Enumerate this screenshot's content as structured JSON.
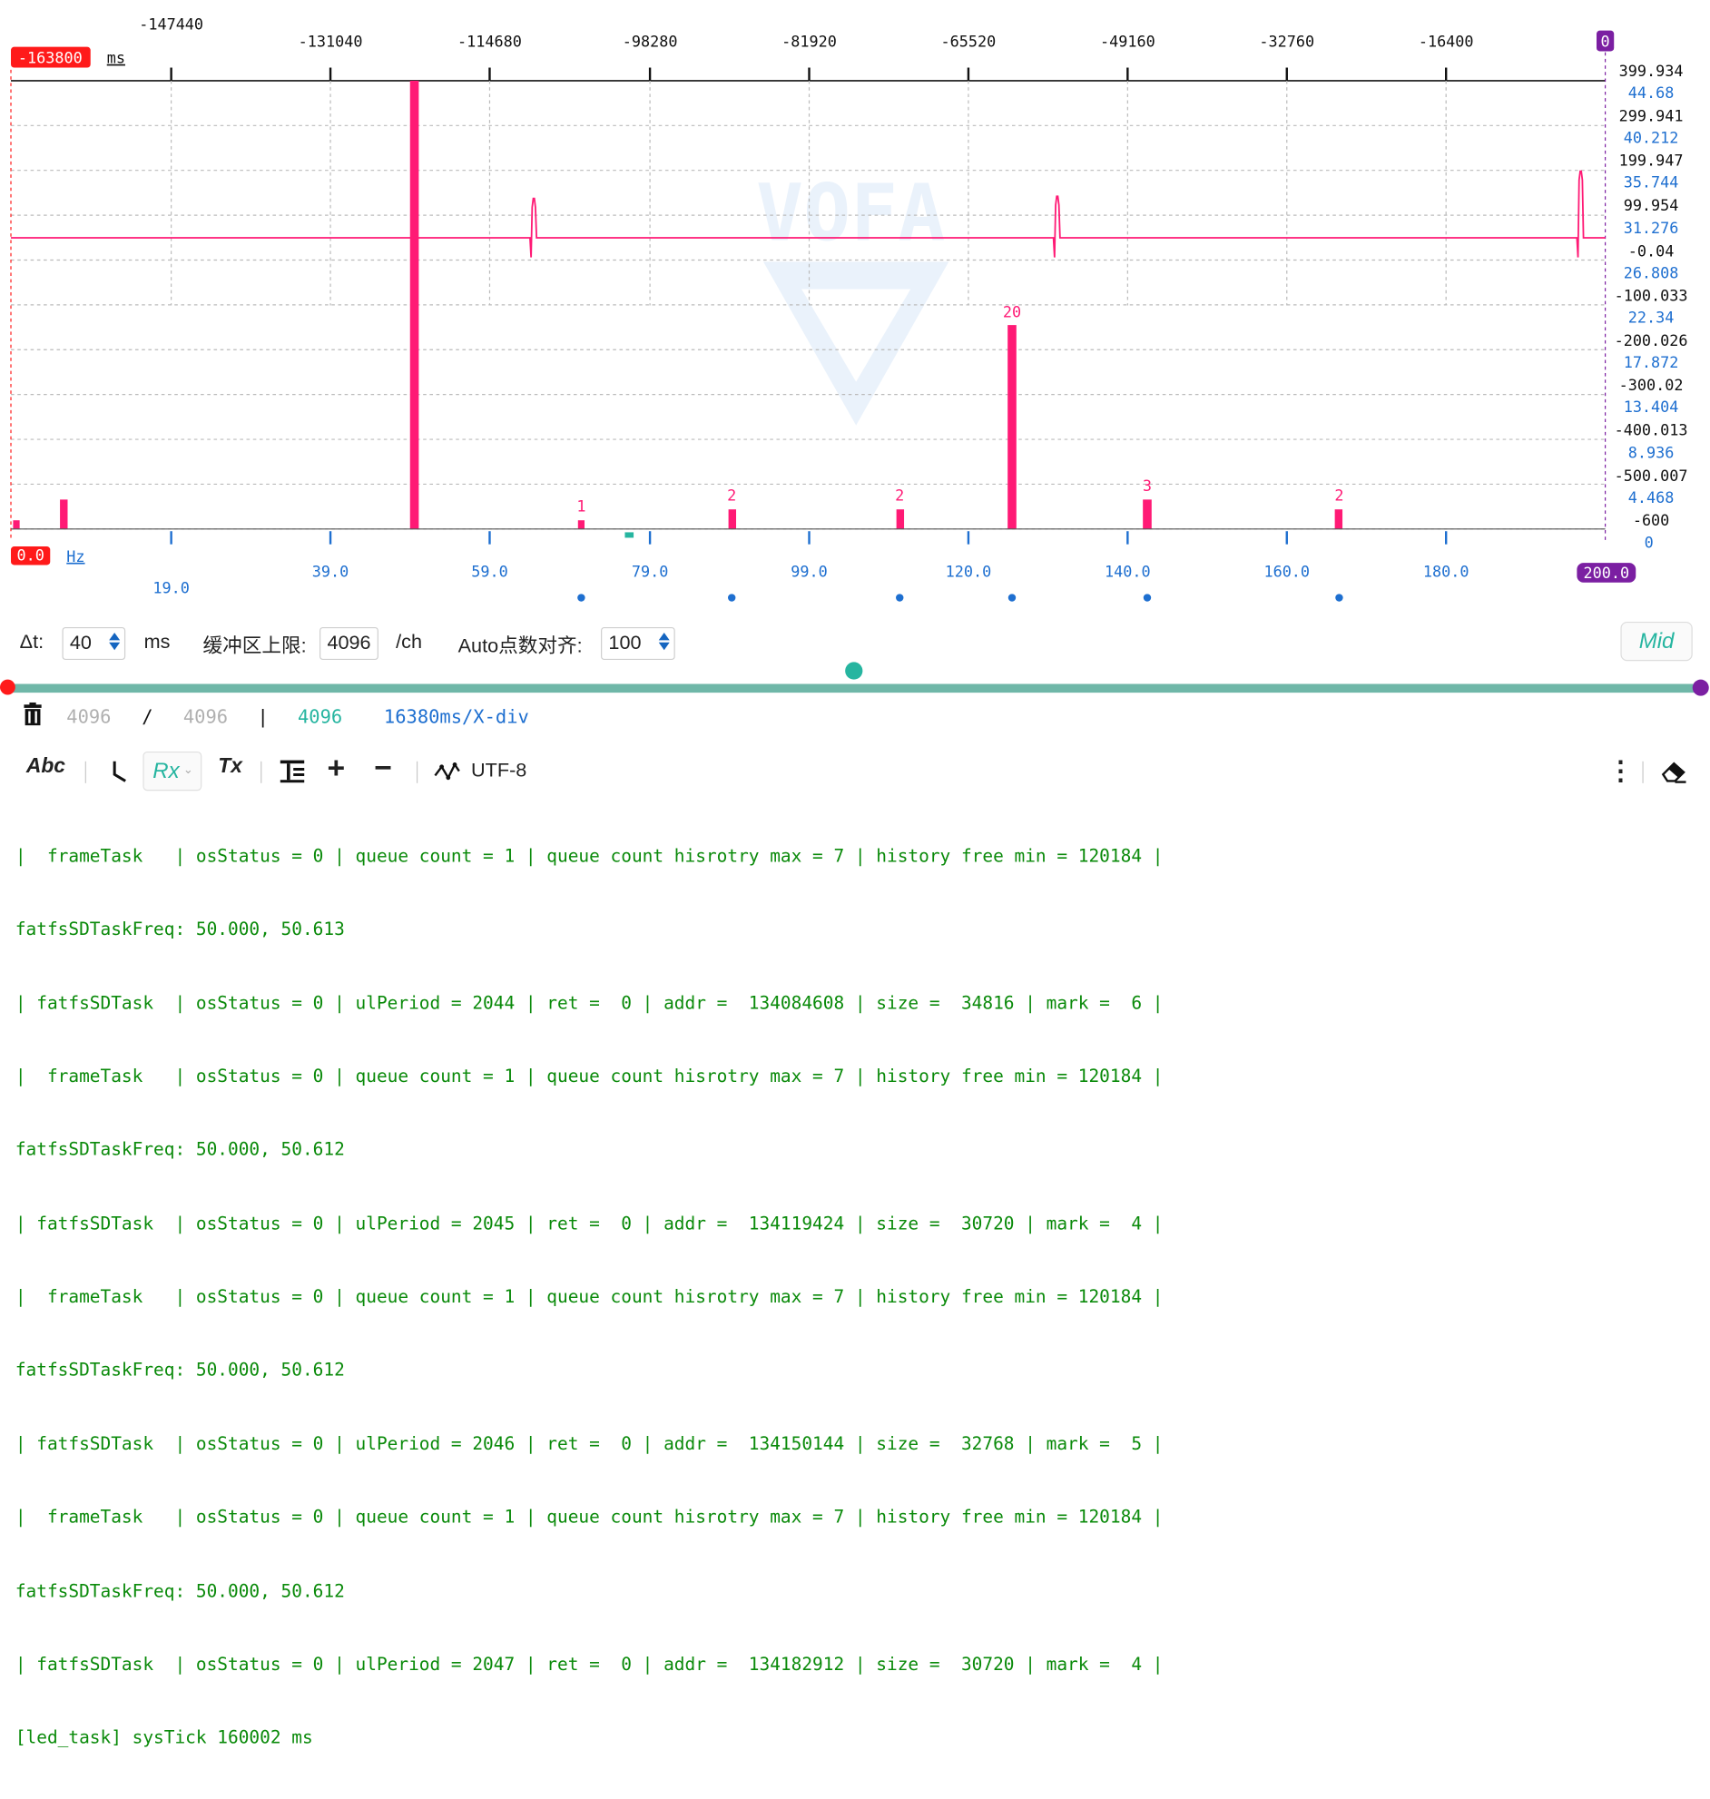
{
  "plot": {
    "top_axis_ticks": [
      "-147440",
      "-131040",
      "-114680",
      "-98280",
      "-81920",
      "-65520",
      "-49160",
      "-32760",
      "-16400"
    ],
    "left_marker": "-163800",
    "time_unit": "ms",
    "right_marker": "0",
    "y_right_black": [
      "399.934",
      "299.941",
      "199.947",
      "99.954",
      "-0.04",
      "-100.033",
      "-200.026",
      "-300.02",
      "-400.013",
      "-500.007",
      "-600"
    ],
    "y_right_blue": [
      "44.68",
      "40.212",
      "35.744",
      "31.276",
      "26.808",
      "22.34",
      "17.872",
      "13.404",
      "8.936",
      "4.468",
      "0"
    ],
    "bottom_axis_ticks": [
      "19.0",
      "39.0",
      "59.0",
      "79.0",
      "99.0",
      "120.0",
      "140.0",
      "160.0",
      "180.0"
    ],
    "freq_left_marker": "0.0",
    "freq_unit": "Hz",
    "freq_right_marker": "200.0",
    "watermark": "VOFA",
    "peak_labels": [
      "1",
      "2",
      "2",
      "20",
      "3",
      "2"
    ]
  },
  "colors": {
    "signal": "#ff1a75",
    "left_marker": "#ff1a1a",
    "right_marker": "#7b1fa2",
    "blue": "#1e6fd0",
    "teal": "#26b5a0",
    "log_text": "#0a8a0a"
  },
  "controls": {
    "dt_label": "Δt:",
    "dt_value": "40",
    "dt_unit": "ms",
    "buffer_label": "缓冲区上限:",
    "buffer_value": "4096",
    "buffer_unit": "/ch",
    "auto_label": "Auto点数对齐:",
    "auto_value": "100",
    "mid_button": "Mid"
  },
  "status": {
    "count_a": "4096",
    "slash": "/",
    "count_b": "4096",
    "bar": "|",
    "count_c": "4096",
    "xdiv": "16380ms/X-div"
  },
  "toolbar": {
    "abc": "Abc",
    "rx": "Rx",
    "tx": "Tx",
    "plus": "+",
    "minus": "−",
    "encoding": "UTF-8"
  },
  "log_lines": [
    "|  frameTask   | osStatus = 0 | queue count = 1 | queue count hisrotry max = 7 | history free min = 120184 |",
    "fatfsSDTaskFreq: 50.000, 50.613",
    "| fatfsSDTask  | osStatus = 0 | ulPeriod = 2044 | ret =  0 | addr =  134084608 | size =  34816 | mark =  6 |",
    "|  frameTask   | osStatus = 0 | queue count = 1 | queue count hisrotry max = 7 | history free min = 120184 |",
    "fatfsSDTaskFreq: 50.000, 50.612",
    "| fatfsSDTask  | osStatus = 0 | ulPeriod = 2045 | ret =  0 | addr =  134119424 | size =  30720 | mark =  4 |",
    "|  frameTask   | osStatus = 0 | queue count = 1 | queue count hisrotry max = 7 | history free min = 120184 |",
    "fatfsSDTaskFreq: 50.000, 50.612",
    "| fatfsSDTask  | osStatus = 0 | ulPeriod = 2046 | ret =  0 | addr =  134150144 | size =  32768 | mark =  5 |",
    "|  frameTask   | osStatus = 0 | queue count = 1 | queue count hisrotry max = 7 | history free min = 120184 |",
    "fatfsSDTaskFreq: 50.000, 50.612",
    "| fatfsSDTask  | osStatus = 0 | ulPeriod = 2047 | ret =  0 | addr =  134182912 | size =  30720 | mark =  4 |",
    "[led_task] sysTick 160002 ms"
  ]
}
